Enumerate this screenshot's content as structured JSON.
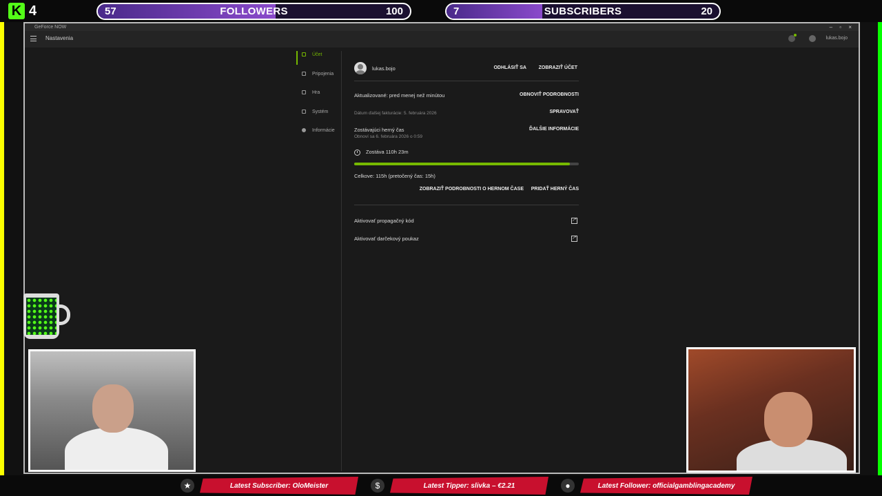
{
  "overlay": {
    "kick_count": "4",
    "followers": {
      "current": "57",
      "label": "FOLLOWERS",
      "goal": "100",
      "progress": 0.57
    },
    "subscribers": {
      "current": "7",
      "label": "SUBSCRIBERS",
      "goal": "20",
      "progress": 0.35
    },
    "latest_subscriber": "Latest Subscriber: OloMeister",
    "latest_tipper": "Latest Tipper: slivka – €2.21",
    "latest_follower": "Latest Follower: officialgamblingacademy"
  },
  "app": {
    "window_title": "GeForce NOW",
    "window_controls": "– ▫ ×",
    "page_title": "Nastavenia",
    "username_header": "lukas.bojo",
    "sidebar": [
      {
        "label": "Účet",
        "icon": "home-icon",
        "active": true
      },
      {
        "label": "Pripojenia",
        "icon": "link-icon",
        "active": false
      },
      {
        "label": "Hra",
        "icon": "gamepad-icon",
        "active": false
      },
      {
        "label": "Systém",
        "icon": "monitor-icon",
        "active": false
      },
      {
        "label": "Informácie",
        "icon": "info-icon",
        "active": false
      }
    ],
    "account": {
      "username": "lukas.bojo",
      "logout": "ODHLÁSIŤ SA",
      "show_account": "ZOBRAZIŤ ÚČET",
      "updated": "Aktualizované: pred menej než minútou",
      "refresh": "OBNOVIŤ PODROBNOSTI",
      "next_billing": "Dátum ďalšej fakturácie: 5. februára 2026",
      "manage": "SPRAVOVAŤ",
      "remaining_title": "Zostávajúci herný čas",
      "renews": "Obnoví sa 6. februára 2026 o 0:59",
      "more_info": "ĎALŠIE INFORMÁCIE",
      "remaining": "Zostáva 110h 23m",
      "progress": 0.96,
      "total": "Celkove: 115h (pretočený čas: 15h)",
      "show_details": "ZOBRAZIŤ PODROBNOSTI O HERNOM ČASE",
      "add_time": "PRIDAŤ HERNÝ ČAS",
      "promo": "Aktivovať propagačný kód",
      "gift": "Aktivovať darčekový poukaz"
    },
    "accent_color": "#76b900"
  }
}
